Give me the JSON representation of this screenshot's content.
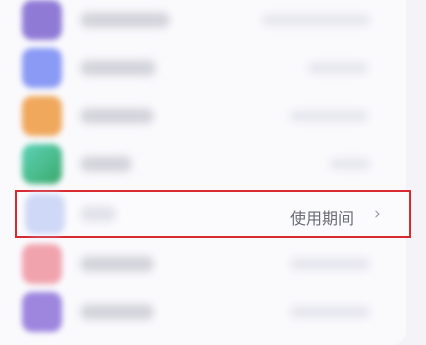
{
  "settings": {
    "highlighted_item": {
      "value_label": "使用期间",
      "chevron": "›"
    }
  },
  "icons": {
    "row1": "purple-app-icon",
    "row2": "blue-app-icon",
    "row3": "orange-app-icon",
    "row4": "green-app-icon",
    "row5": "lightblue-app-icon",
    "row6": "red-app-icon",
    "row7": "purple-app-icon"
  },
  "colors": {
    "highlight_border": "#d82a31",
    "value_text": "#6b6b75"
  }
}
